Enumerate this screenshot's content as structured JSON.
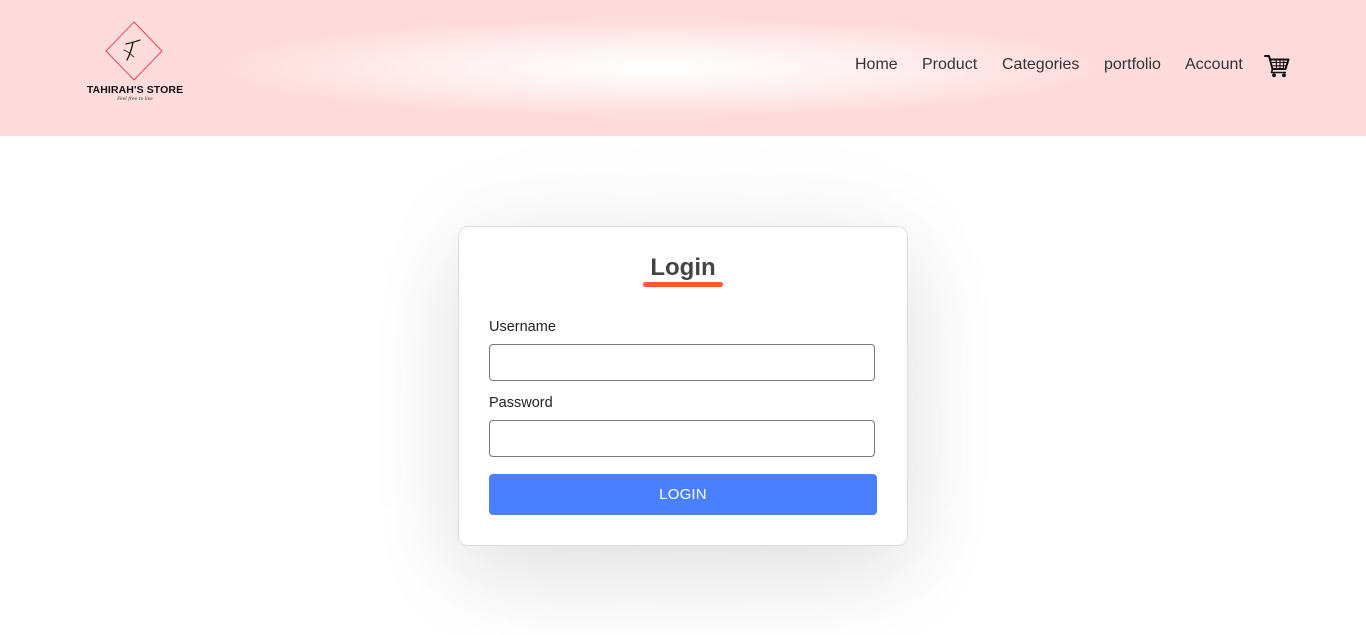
{
  "brand": {
    "name": "TAHIRAH'S STORE",
    "tagline": "Feel free to live",
    "accent_color": "#e63946"
  },
  "nav": {
    "items": [
      {
        "label": "Home"
      },
      {
        "label": "Product"
      },
      {
        "label": "Categories"
      },
      {
        "label": "portfolio"
      },
      {
        "label": "Account"
      }
    ],
    "cart_icon": "shopping-cart-icon"
  },
  "login": {
    "title": "Login",
    "title_underline_color": "#ff5733",
    "username_label": "Username",
    "username_value": "",
    "password_label": "Password",
    "password_value": "",
    "button_label": "LOGIN",
    "button_color": "#4a80ff"
  },
  "colors": {
    "header_bg": "#ffdcdc",
    "text": "#333333"
  }
}
